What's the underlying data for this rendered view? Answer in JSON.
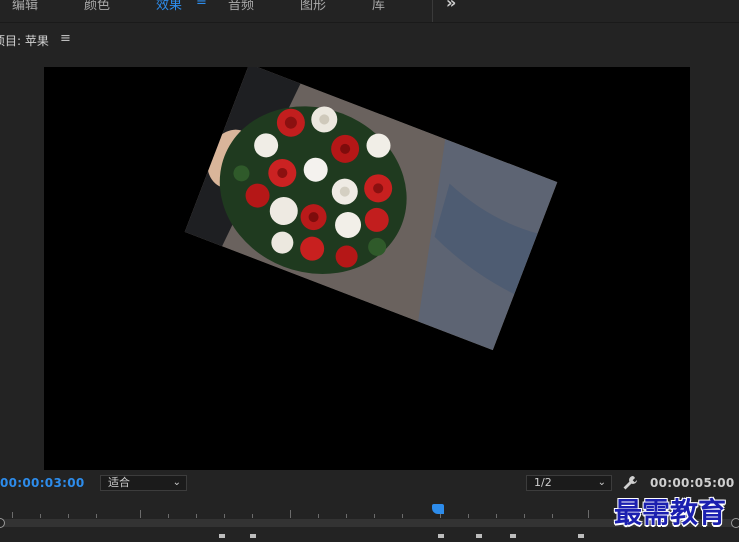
{
  "tabs": [
    {
      "label": "编辑",
      "active": false
    },
    {
      "label": "颜色",
      "active": false
    },
    {
      "label": "效果",
      "active": true
    },
    {
      "label": "音频",
      "active": false
    },
    {
      "label": "图形",
      "active": false
    },
    {
      "label": "库",
      "active": false
    }
  ],
  "program_monitor": {
    "title": "项目: 苹果"
  },
  "controls": {
    "current_timecode": "00:00:03:00",
    "zoom_select": "适合",
    "resolution_select": "1/2",
    "duration_timecode": "00:00:05:00"
  },
  "watermark": "最需教育",
  "colors": {
    "accent": "#2d8ceb",
    "panel_bg": "#232323",
    "viewer_bg": "#000000",
    "watermark": "#1b1fb0"
  },
  "icons": {
    "tab_menu": "hamburger-icon",
    "overflow": "double-chevron-right-icon",
    "panel_menu": "hamburger-icon",
    "settings": "wrench-icon"
  }
}
